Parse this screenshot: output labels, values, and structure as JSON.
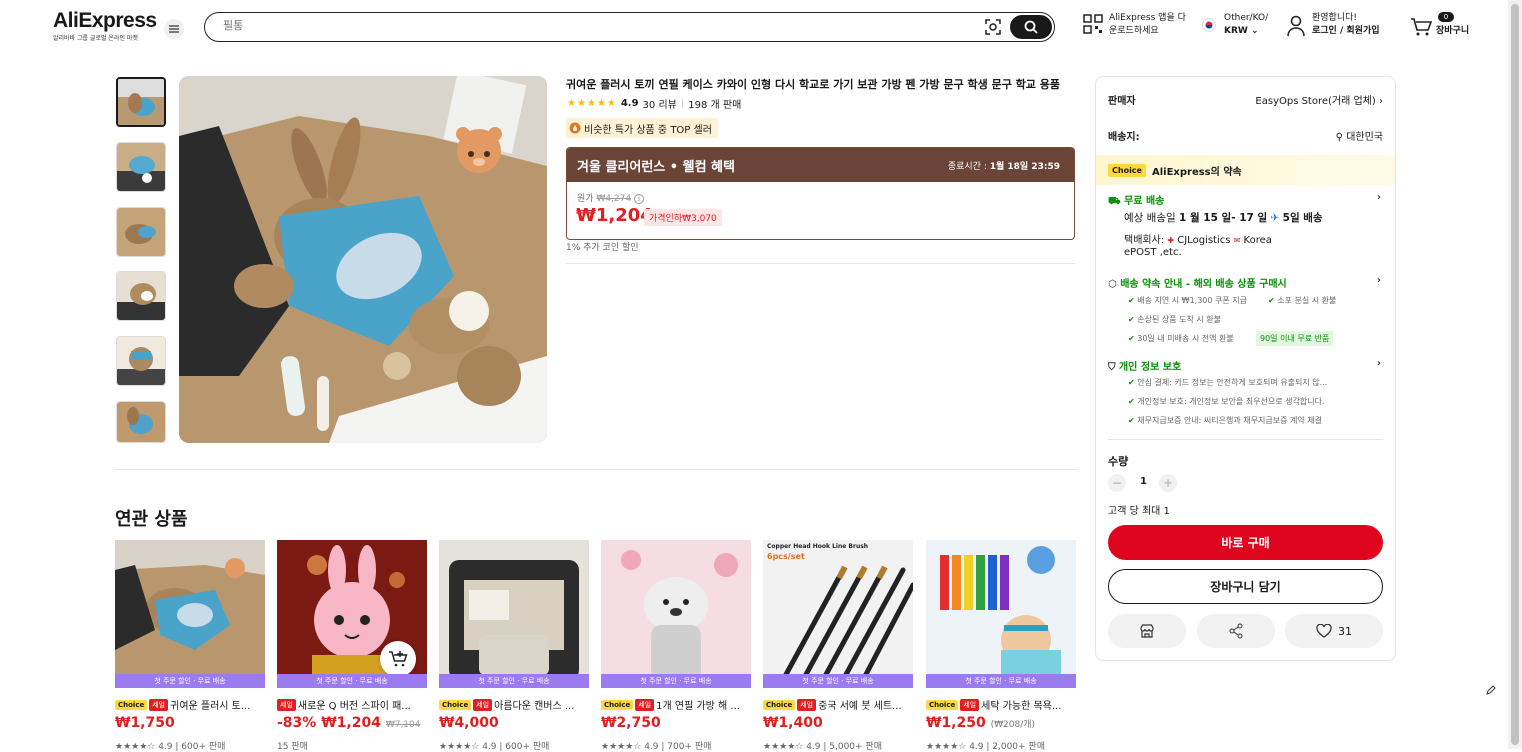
{
  "header": {
    "logo": "AliExpress",
    "logo_sub": "알리바바 그룹 글로벌 온라인 마켓",
    "search_placeholder": "필통",
    "app_line1": "AliExpress 앱을 다",
    "app_line2": "운로드하세요",
    "locale_line1": "Other/KO/",
    "locale_line2": "KRW",
    "account_line1": "환영합니다!",
    "account_line2": "로그인 / 회원가입",
    "cart_count": "0",
    "cart_label": "장바구니"
  },
  "product": {
    "title": "귀여운 플러시 토끼 연필 케이스 카와이 인형 다시 학교로 가기 보관 가방 펜 가방 문구 학생 문구 학교 용품",
    "stars": "★★★★★",
    "rating": "4.9",
    "reviews": "30 리뷰",
    "sold": "198 개 판매",
    "top_seller": "비슷한 특가 상품 중 TOP 셀러",
    "promo_title": "겨울 클리어런스 • 웰컴 혜택",
    "promo_end_label": "종료시간 :",
    "promo_end_time": "1월 18일 23:59",
    "original_label": "원가",
    "original_price": "₩4,274",
    "price": "₩1,204",
    "discount": "가격인하₩3,070",
    "coin": "1% 추가 코인 할인"
  },
  "panel": {
    "seller_label": "판매자",
    "seller_value": "EasyOps Store(거래 업체)",
    "ship_label": "배송지:",
    "ship_value": "대한민국",
    "choice_badge": "Choice",
    "choice_title": "AliExpress의 약속",
    "free_ship": "무료 배송",
    "delivery_prefix": "예상 배송일",
    "delivery_dates": "1 월 15 일- 17 일",
    "delivery_fast": "5일 배송",
    "carrier_prefix": "택배회사:",
    "carrier_1": "CJLogistics",
    "carrier_2": "Korea",
    "carrier_3": "ePOST ,etc.",
    "guarantee_title": "배송 약속 안내 - 해외 배송 상품 구매시",
    "guarantee_1": "배송 지연 시 ₩1,300 쿠폰 지급",
    "guarantee_2": "소포 분실 시 환불",
    "guarantee_3": "손상된 상품 도착 시 환불",
    "guarantee_4": "30일 내 미배송 시 전액 환불",
    "guarantee_5": "90일 이내 무료 반품",
    "privacy_title": "개인 정보 보호",
    "privacy_1": "안심 결제: 카드 정보는 안전하게 보호되며 유출되지 않...",
    "privacy_2": "개인정보 보호: 개인정보 보안을 최우선으로 생각합니다.",
    "privacy_3": "채무지급보증 안내: 씨티은행과 채무지급보증 계약 체결",
    "qty_label": "수량",
    "qty_minus": "−",
    "qty_value": "1",
    "qty_plus": "+",
    "qty_limit": "고객 당 최대 1",
    "buy_now": "바로 구매",
    "add_cart": "장바구니 담기",
    "wish_count": "31"
  },
  "related": {
    "title": "연관 상품",
    "band_text": "첫 주문 할인 · 무료 배송",
    "choice": "Choice",
    "sale": "세일",
    "items": [
      {
        "name": "귀여운 플러시 토...",
        "price": "₩1,750",
        "meta": "★★★★☆ 4.9 | 600+ 판매",
        "choice": true
      },
      {
        "name": "새로운 Q 버전 스파이 패...",
        "discount": "-83%",
        "price": "₩1,204",
        "old": "₩7,104",
        "meta": "15 판매",
        "choice": false
      },
      {
        "name": "아름다운 캔버스 ...",
        "price": "₩4,000",
        "meta": "★★★★☆ 4.9 | 600+ 판매",
        "choice": true
      },
      {
        "name": "1개 연필 가방 해 ...",
        "price": "₩2,750",
        "meta": "★★★★☆ 4.9 | 700+ 판매",
        "choice": true
      },
      {
        "name": "중국 서예 붓 세트...",
        "price": "₩1,400",
        "meta": "★★★★☆ 4.9 | 5,000+ 판매",
        "choice": true
      },
      {
        "name": "세탁 가능한 목욕...",
        "price": "₩1,250",
        "unit": "(₩208/개)",
        "meta": "★★★★☆ 4.9 | 2,000+ 판매",
        "choice": true
      }
    ],
    "card5_label": "Copper Head Hook Line Brush",
    "card5_sub": "6pcs/set"
  },
  "colors": {
    "accent": "#e02020",
    "promo": "#6b4438",
    "choice": "#ffd83b",
    "green": "#0a8f08"
  }
}
